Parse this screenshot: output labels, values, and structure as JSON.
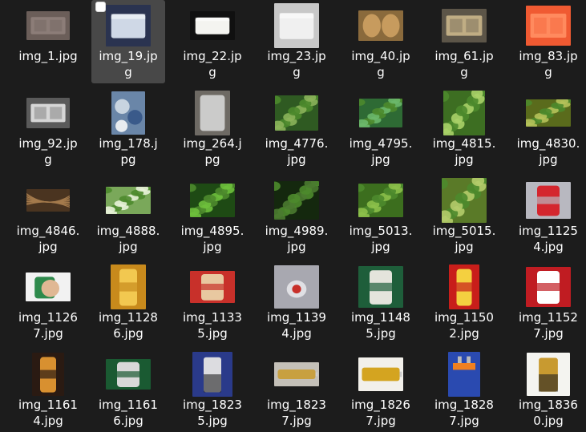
{
  "files": [
    {
      "label": "img_1.jpg",
      "icon": "metal-tray-thumbnail",
      "size": [
        54,
        36
      ],
      "c1": "#6b5e59",
      "c2": "#8c7d78",
      "kind": "tray"
    },
    {
      "label": "img_19.jp\ng",
      "icon": "plastic-container-thumbnail",
      "size": [
        56,
        52
      ],
      "c1": "#2a3350",
      "c2": "#cfd8e6",
      "kind": "box",
      "selected": true,
      "checkbox": true
    },
    {
      "label": "img_22.jp\ng",
      "icon": "foam-container-thumbnail",
      "size": [
        56,
        36
      ],
      "c1": "#101010",
      "c2": "#f4f4f0",
      "kind": "box"
    },
    {
      "label": "img_23.jp\ng",
      "icon": "foam-box-thumbnail",
      "size": [
        56,
        56
      ],
      "c1": "#c8c8c8",
      "c2": "#f0f0f0",
      "kind": "box"
    },
    {
      "label": "img_40.jp\ng",
      "icon": "paper-bowl-thumbnail",
      "size": [
        56,
        38
      ],
      "c1": "#8a6a3c",
      "c2": "#c79b5e",
      "kind": "bowl"
    },
    {
      "label": "img_61.jp\ng",
      "icon": "plastic-tray-thumbnail",
      "size": [
        56,
        42
      ],
      "c1": "#5c5548",
      "c2": "#c0ad84",
      "kind": "tray"
    },
    {
      "label": "img_83.jp\ng",
      "icon": "orange-tray-thumbnail",
      "size": [
        56,
        50
      ],
      "c1": "#f05a32",
      "c2": "#ff8a5e",
      "kind": "tray"
    },
    {
      "label": "img_92.jp\ng",
      "icon": "clear-tray-thumbnail",
      "size": [
        54,
        38
      ],
      "c1": "#5a5a5a",
      "c2": "#d6d6d6",
      "kind": "tray"
    },
    {
      "label": "img_178.j\npg",
      "icon": "cups-thumbnail",
      "size": [
        42,
        54
      ],
      "c1": "#6a86a8",
      "c2": "#c8d4e0",
      "kind": "cups"
    },
    {
      "label": "img_264.j\npg",
      "icon": "plastic-bag-thumbnail",
      "size": [
        44,
        56
      ],
      "c1": "#6e6a64",
      "c2": "#dcdcdc",
      "kind": "bag"
    },
    {
      "label": "img_4776.\njpg",
      "icon": "vegetable-bowl-thumbnail",
      "size": [
        54,
        44
      ],
      "c1": "#2f5a22",
      "c2": "#8bb35a",
      "kind": "greens"
    },
    {
      "label": "img_4795.\njpg",
      "icon": "leafy-greens-thumbnail",
      "size": [
        54,
        36
      ],
      "c1": "#2e6a34",
      "c2": "#6bb86a",
      "kind": "greens"
    },
    {
      "label": "img_4815.\njpg",
      "icon": "bok-choy-thumbnail",
      "size": [
        52,
        56
      ],
      "c1": "#3d6e22",
      "c2": "#a8d068",
      "kind": "greens"
    },
    {
      "label": "img_4830.\njpg",
      "icon": "beans-thumbnail",
      "size": [
        56,
        34
      ],
      "c1": "#5a6b1c",
      "c2": "#b5c25a",
      "kind": "greens"
    },
    {
      "label": "img_4846.\njpg",
      "icon": "straw-thumbnail",
      "size": [
        54,
        28
      ],
      "c1": "#4a3420",
      "c2": "#a47a4c",
      "kind": "straw"
    },
    {
      "label": "img_4888.\njpg",
      "icon": "cabbage-thumbnail",
      "size": [
        56,
        34
      ],
      "c1": "#7aa85a",
      "c2": "#e8f2d8",
      "kind": "greens"
    },
    {
      "label": "img_4895.\njpg",
      "icon": "spinach-thumbnail",
      "size": [
        56,
        42
      ],
      "c1": "#1e4a14",
      "c2": "#6ec03c",
      "kind": "greens"
    },
    {
      "label": "img_4989.\njpg",
      "icon": "herbs-thumbnail",
      "size": [
        56,
        48
      ],
      "c1": "#14280e",
      "c2": "#4a7a30",
      "kind": "greens"
    },
    {
      "label": "img_5013.\njpg",
      "icon": "green-beans-thumbnail",
      "size": [
        56,
        42
      ],
      "c1": "#3c6e1e",
      "c2": "#8cc04a",
      "kind": "greens"
    },
    {
      "label": "img_5015.\njpg",
      "icon": "lettuce-thumbnail",
      "size": [
        56,
        56
      ],
      "c1": "#5a7a28",
      "c2": "#b4cc6a",
      "kind": "greens"
    },
    {
      "label": "img_1125\n4.jpg",
      "icon": "crushed-can-thumbnail",
      "size": [
        56,
        46
      ],
      "c1": "#b8b8c0",
      "c2": "#d4262e",
      "kind": "can"
    },
    {
      "label": "img_1126\n7.jpg",
      "icon": "green-can-thumbnail",
      "size": [
        56,
        36
      ],
      "c1": "#f2f2f2",
      "c2": "#2e8a4c",
      "kind": "hand"
    },
    {
      "label": "img_1128\n6.jpg",
      "icon": "beer-can-thumbnail",
      "size": [
        44,
        56
      ],
      "c1": "#c88a1c",
      "c2": "#f2c850",
      "kind": "can"
    },
    {
      "label": "img_1133\n5.jpg",
      "icon": "red-cans-thumbnail",
      "size": [
        56,
        40
      ],
      "c1": "#c8302a",
      "c2": "#e8c8a0",
      "kind": "can"
    },
    {
      "label": "img_1139\n4.jpg",
      "icon": "can-top-thumbnail",
      "size": [
        56,
        54
      ],
      "c1": "#a8a8b0",
      "c2": "#e0e0e4",
      "kind": "cantop"
    },
    {
      "label": "img_1148\n5.jpg",
      "icon": "beer-can-thumbnail",
      "size": [
        56,
        52
      ],
      "c1": "#1e5e3a",
      "c2": "#e4e4dc",
      "kind": "can"
    },
    {
      "label": "img_1150\n2.jpg",
      "icon": "red-tea-can-thumbnail",
      "size": [
        38,
        56
      ],
      "c1": "#c81e1a",
      "c2": "#f4d040",
      "kind": "can"
    },
    {
      "label": "img_1152\n7.jpg",
      "icon": "cola-cans-thumbnail",
      "size": [
        56,
        50
      ],
      "c1": "#c01c22",
      "c2": "#ffffff",
      "kind": "can"
    },
    {
      "label": "img_1161\n4.jpg",
      "icon": "beer-glass-thumbnail",
      "size": [
        40,
        54
      ],
      "c1": "#2a1a12",
      "c2": "#d89030",
      "kind": "can"
    },
    {
      "label": "img_1161\n6.jpg",
      "icon": "beer-can-thumbnail",
      "size": [
        56,
        38
      ],
      "c1": "#1a5a32",
      "c2": "#d8d8d8",
      "kind": "can"
    },
    {
      "label": "img_1823\n5.jpg",
      "icon": "batteries-thumbnail",
      "size": [
        50,
        56
      ],
      "c1": "#2a3a8a",
      "c2": "#dcdce0",
      "kind": "battery"
    },
    {
      "label": "img_1823\n7.jpg",
      "icon": "battery-thumbnail",
      "size": [
        56,
        30
      ],
      "c1": "#c4c0b8",
      "c2": "#c8a040",
      "kind": "batteryh"
    },
    {
      "label": "img_1826\n7.jpg",
      "icon": "batteries-thumbnail",
      "size": [
        56,
        42
      ],
      "c1": "#f2f0ea",
      "c2": "#d4a420",
      "kind": "batteryh"
    },
    {
      "label": "img_1828\n7.jpg",
      "icon": "9v-battery-thumbnail",
      "size": [
        40,
        56
      ],
      "c1": "#2a4ab0",
      "c2": "#e0e0e0",
      "kind": "battery9"
    },
    {
      "label": "img_1836\n0.jpg",
      "icon": "battery-thumbnail",
      "size": [
        54,
        54
      ],
      "c1": "#f4f4f0",
      "c2": "#c89a30",
      "kind": "battery"
    }
  ]
}
